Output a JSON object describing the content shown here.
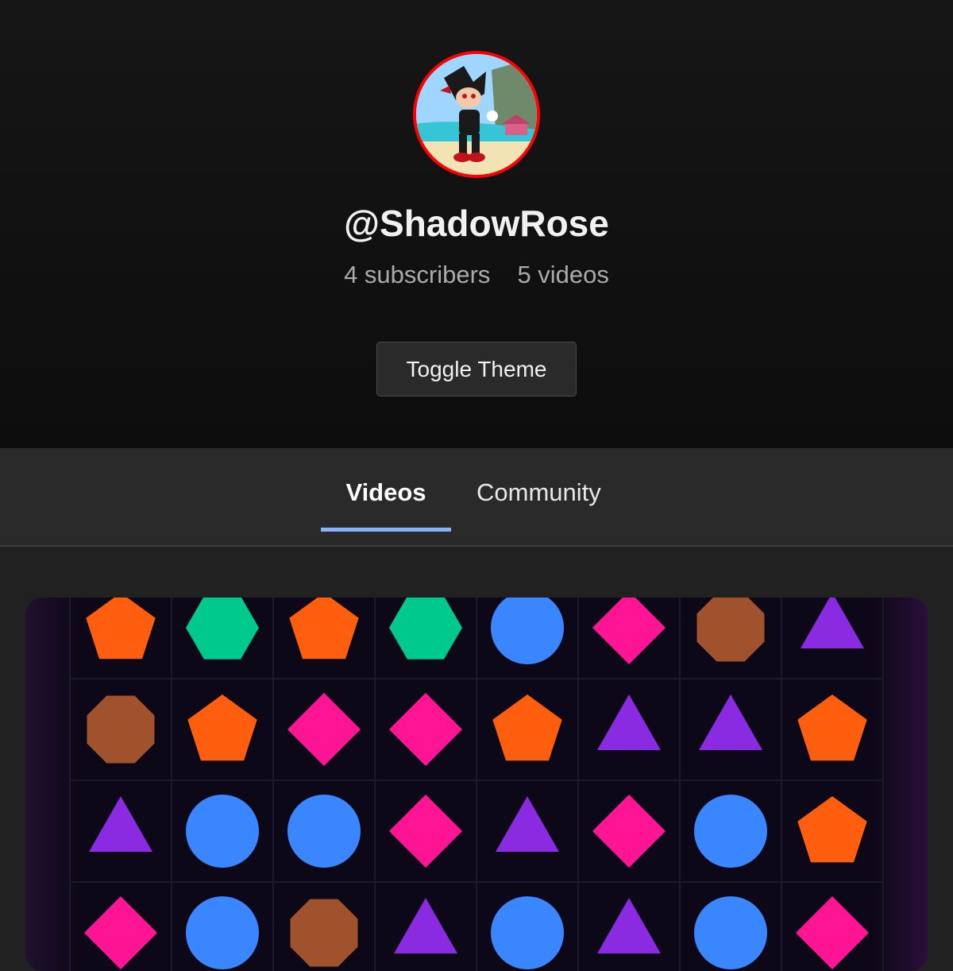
{
  "channel": {
    "handle": "@ShadowRose",
    "subscribers": "4 subscribers",
    "videos": "5 videos"
  },
  "header": {
    "toggle_label": "Toggle Theme"
  },
  "tabs": [
    {
      "label": "Videos",
      "active": true
    },
    {
      "label": "Community",
      "active": false
    }
  ],
  "colors": {
    "accent_underline": "#8ab4f8",
    "avatar_border": "#ff0000",
    "pentagon": "#ff5e0e",
    "hexagon": "#00c98d",
    "circle": "#3a86ff",
    "diamond": "#ff1493",
    "octagon": "#a0522d",
    "triangle": "#8a2be2"
  },
  "game_board": {
    "columns": 8,
    "rows": [
      [
        "pentagon",
        "hexagon",
        "pentagon",
        "hexagon",
        "circle",
        "diamond",
        "octagon",
        "triangle"
      ],
      [
        "octagon",
        "pentagon",
        "diamond",
        "diamond",
        "pentagon",
        "triangle",
        "triangle",
        "pentagon"
      ],
      [
        "triangle",
        "circle",
        "circle",
        "diamond",
        "triangle",
        "diamond",
        "circle",
        "pentagon"
      ],
      [
        "diamond",
        "circle",
        "octagon",
        "triangle",
        "circle",
        "triangle",
        "circle",
        "diamond"
      ]
    ]
  }
}
